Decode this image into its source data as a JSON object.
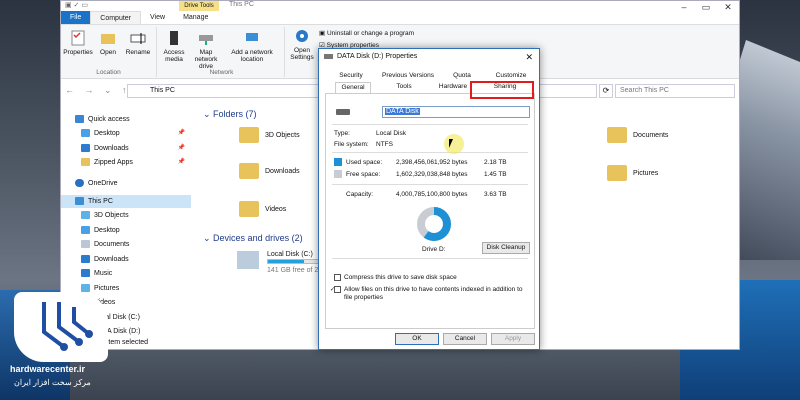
{
  "window": {
    "ribbon_context": "Drive Tools",
    "title": "This PC",
    "tabs": [
      "File",
      "Computer",
      "View",
      "Manage"
    ]
  },
  "ribbon": {
    "location": {
      "buttons": [
        "Properties",
        "Open",
        "Rename"
      ],
      "label": "Location"
    },
    "network": {
      "buttons": [
        "Access media",
        "Map network drive",
        "Add a network location"
      ],
      "label": "Network"
    },
    "system": {
      "open_settings": "Open Settings",
      "uninstall": "Uninstall or change a program",
      "system_properties": "System properties"
    }
  },
  "address": {
    "path": "This PC",
    "search_placeholder": "Search This PC"
  },
  "sidebar": {
    "items": [
      {
        "label": "Quick access",
        "icon": "star-icon"
      },
      {
        "label": "Desktop",
        "icon": "desktop-icon",
        "pinned": true
      },
      {
        "label": "Downloads",
        "icon": "download-icon",
        "pinned": true
      },
      {
        "label": "Zipped Apps",
        "icon": "folder-icon",
        "pinned": true
      },
      {
        "label": "OneDrive",
        "icon": "cloud-icon"
      },
      {
        "label": "This PC",
        "icon": "computer-icon",
        "selected": true
      },
      {
        "label": "3D Objects",
        "icon": "cube-icon"
      },
      {
        "label": "Desktop",
        "icon": "desktop-icon"
      },
      {
        "label": "Documents",
        "icon": "document-icon"
      },
      {
        "label": "Downloads",
        "icon": "download-icon"
      },
      {
        "label": "Music",
        "icon": "music-icon"
      },
      {
        "label": "Pictures",
        "icon": "picture-icon"
      },
      {
        "label": "Videos",
        "icon": "video-icon"
      },
      {
        "label": "Local Disk (C:)",
        "icon": "drive-icon"
      },
      {
        "label": "DATA Disk (D:)",
        "icon": "drive-icon"
      }
    ]
  },
  "content": {
    "folders_header": "Folders (7)",
    "folders": [
      "3D Objects",
      "Downloads",
      "Videos",
      "Documents",
      "Pictures"
    ],
    "drives_header": "Devices and drives (2)",
    "drive": {
      "name": "Local Disk (C:)",
      "free": "141 GB free of 2"
    }
  },
  "status": {
    "text": "1 item selected"
  },
  "dialog": {
    "title": "DATA Disk (D:) Properties",
    "tabs_row1": [
      "Security",
      "Previous Versions",
      "Quota",
      "Customize"
    ],
    "tabs_row2": [
      "General",
      "Tools",
      "Hardware",
      "Sharing"
    ],
    "name_value": "DATA Disk",
    "type_label": "Type:",
    "type_value": "Local Disk",
    "fs_label": "File system:",
    "fs_value": "NTFS",
    "used_label": "Used space:",
    "used_bytes": "2,398,456,061,952 bytes",
    "used_size": "2.18 TB",
    "free_label": "Free space:",
    "free_bytes": "1,602,329,038,848 bytes",
    "free_size": "1.45 TB",
    "capacity_label": "Capacity:",
    "capacity_bytes": "4,000,785,100,800 bytes",
    "capacity_size": "3.63 TB",
    "drive_label": "Drive D:",
    "cleanup": "Disk Cleanup",
    "compress": "Compress this drive to save disk space",
    "index": "Allow files on this drive to have contents indexed in addition to file properties",
    "ok": "OK",
    "cancel": "Cancel",
    "apply": "Apply",
    "used_fraction": 0.6,
    "used_color": "#1e90d6",
    "free_color": "#c9cdd3"
  },
  "logo": {
    "site": "hardwarecenter.ir",
    "tagline": "مرکز سخت افزار ایران"
  }
}
